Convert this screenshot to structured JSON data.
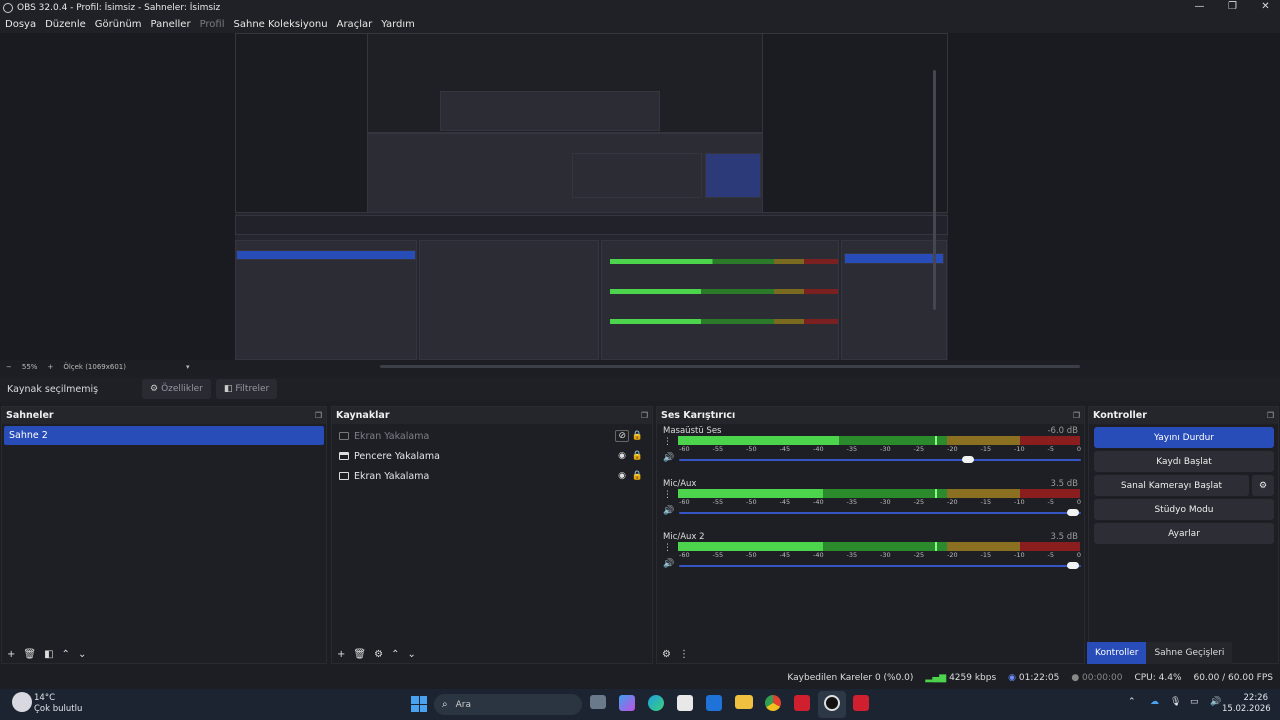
{
  "window": {
    "title": "OBS 32.0.4 - Profil: İsimsiz - Sahneler: İsimsiz",
    "controls": [
      "—",
      "❐",
      "✕"
    ]
  },
  "menu": [
    "Dosya",
    "Düzenle",
    "Görünüm",
    "Paneller",
    "Profil",
    "Sahne Koleksiyonu",
    "Araçlar",
    "Yardım"
  ],
  "zoom": {
    "minus": "−",
    "value": "55%",
    "plus": "+",
    "scale": "Ölçek (1069x601)"
  },
  "source_bar": {
    "label": "Kaynak seçilmemiş",
    "properties": "Özellikler",
    "filters": "Filtreler"
  },
  "scenes": {
    "title": "Sahneler",
    "items": [
      "Sahne 2"
    ]
  },
  "sources": {
    "title": "Kaynaklar",
    "items": [
      {
        "name": "Ekran Yakalama",
        "hidden": true
      },
      {
        "name": "Pencere Yakalama",
        "hidden": false
      },
      {
        "name": "Ekran Yakalama",
        "hidden": false
      }
    ]
  },
  "mixer": {
    "title": "Ses Karıştırıcı",
    "ticks": [
      "-60",
      "-55",
      "-50",
      "-45",
      "-40",
      "-35",
      "-30",
      "-25",
      "-20",
      "-15",
      "-10",
      "-5",
      "0"
    ],
    "channels": [
      {
        "name": "Masaüstü Ses",
        "db": "-6.0 dB",
        "level": 0.4,
        "peak": 0.64,
        "volume": 0.72
      },
      {
        "name": "Mic/Aux",
        "db": "3.5 dB",
        "level": 0.36,
        "peak": 0.64,
        "volume": 0.98
      },
      {
        "name": "Mic/Aux 2",
        "db": "3.5 dB",
        "level": 0.36,
        "peak": 0.64,
        "volume": 0.98
      }
    ]
  },
  "controls": {
    "title": "Kontroller",
    "stop_stream": "Yayını Durdur",
    "start_record": "Kaydı Başlat",
    "virtual_cam": "Sanal Kamerayı Başlat",
    "studio": "Stüdyo Modu",
    "settings": "Ayarlar"
  },
  "dock_tabs": {
    "controls": "Kontroller",
    "transitions": "Sahne Geçişleri"
  },
  "status": {
    "dropped": "Kaybedilen Kareler 0 (%0.0)",
    "bitrate": "4259 kbps",
    "stream_time": "01:22:05",
    "record_time": "00:00:00",
    "cpu": "CPU: 4.4%",
    "fps": "60.00 / 60.00 FPS"
  },
  "taskbar": {
    "weather_temp": "14°C",
    "weather_desc": "Çok bulutlu",
    "search": "Ara",
    "time": "22:26",
    "date": "15.02.2026"
  },
  "colors": {
    "accent": "#284cb8",
    "meter_green": "#4cd44c",
    "meter_yellow": "#b8a020",
    "meter_red": "#b82828"
  }
}
